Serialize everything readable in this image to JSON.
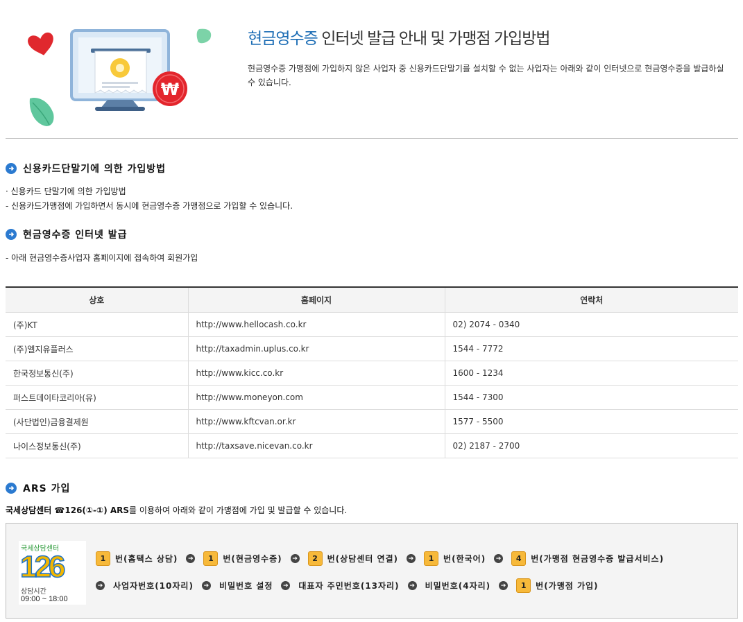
{
  "header": {
    "title_accent": "현금영수증",
    "title_rest": " 인터넷 발급 안내 및 가맹점 가입방법",
    "description": "현금영수증 가맹점에 가입하지 않은 사업자 중 신용카드단말기를 설치할 수 없는 사업자는 아래와 같이 인터넷으로 현금영수증을 발급하실 수 있습니다."
  },
  "section_card": {
    "title": "신용카드단말기에 의한 가입방법",
    "line1": "· 신용카드 단말기에 의한 가입방법",
    "line2": " - 신용카드가맹점에 가입하면서 동시에 현금영수증 가맹점으로 가입할 수 있습니다."
  },
  "section_internet": {
    "title": "현금영수증 인터넷 발급",
    "line1": "- 아래 현금영수증사업자 홈페이지에 접속하여 회원가입"
  },
  "table": {
    "headers": [
      "상호",
      "홈페이지",
      "연락처"
    ],
    "rows": [
      [
        "(주)KT",
        "http://www.hellocash.co.kr",
        "02) 2074 - 0340"
      ],
      [
        "(주)엘지유플러스",
        "http://taxadmin.uplus.co.kr",
        "1544 - 7772"
      ],
      [
        "한국정보통신(주)",
        "http://www.kicc.co.kr",
        "1600 - 1234"
      ],
      [
        "퍼스트데이타코리아(유)",
        "http://www.moneyon.com",
        "1544 - 7300"
      ],
      [
        "(사단법인)금융결제원",
        "http://www.kftcvan.or.kr",
        "1577 - 5500"
      ],
      [
        "나이스정보통신(주)",
        "http://taxsave.nicevan.co.kr",
        "02) 2187 - 2700"
      ]
    ]
  },
  "section_ars": {
    "title": "ARS 가입",
    "note_bold": "국세상담센터 ☎126(①-①) ARS",
    "note_rest": "를 이용하여 아래와 같이 가맹점에 가입 및 발급할 수 있습니다.",
    "logo": {
      "top_text": "국세상담센터",
      "number": "126",
      "hours_label": "상담시간",
      "hours": "09:00 ~ 18:00"
    },
    "row1": [
      {
        "num": "1",
        "text": "번(홈택스 상담)"
      },
      {
        "num": "1",
        "text": "번(현금영수증)"
      },
      {
        "num": "2",
        "text": "번(상담센터 연결)"
      },
      {
        "num": "1",
        "text": "번(한국어)"
      },
      {
        "num": "4",
        "text": "번(가맹점 현금영수증 발급서비스)"
      }
    ],
    "row2": [
      {
        "text": "사업자번호(10자리)"
      },
      {
        "text": "비밀번호 설정"
      },
      {
        "text": "대표자 주민번호(13자리)"
      },
      {
        "text": "비밀번호(4자리)"
      },
      {
        "num": "1",
        "text": "번(가맹점 가입)"
      }
    ]
  },
  "colors": {
    "accent": "#1c6db5",
    "bullet": "#2b7ad0",
    "step_badge": "#f7b93a"
  }
}
